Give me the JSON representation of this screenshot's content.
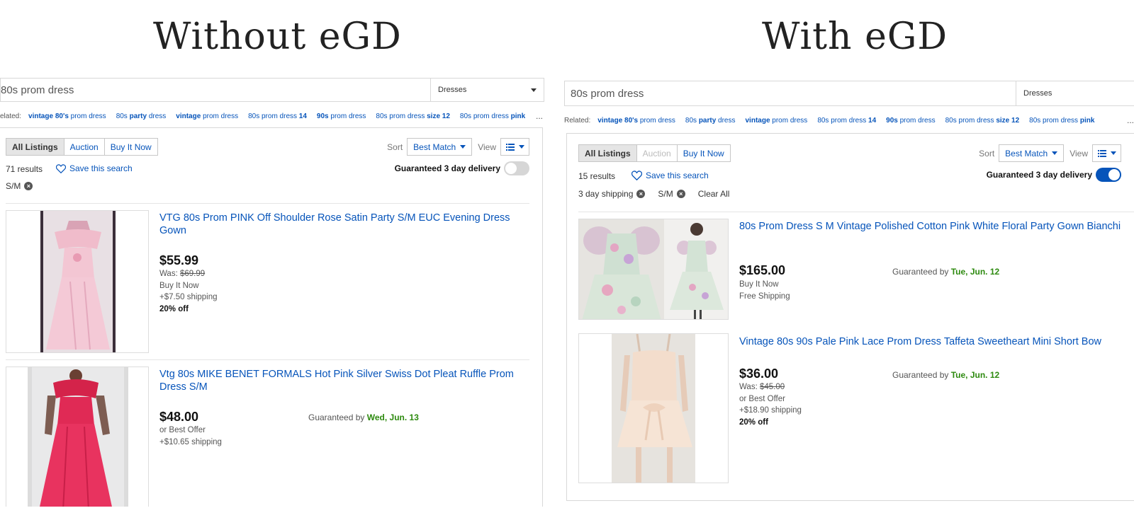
{
  "headings": {
    "left": "Without eGD",
    "right": "With eGD"
  },
  "colors": {
    "link": "#0654ba",
    "date_green": "#2d8a0f",
    "toggle_on": "#0654ba",
    "toggle_off": "#d6d6d6"
  },
  "left": {
    "search": {
      "query": "80s prom dress",
      "category": "Dresses"
    },
    "related": {
      "label": "elated:",
      "keywords": [
        {
          "normal1": "",
          "bold": "vintage 80's",
          "normal2": " prom dress"
        },
        {
          "normal1": "80s ",
          "bold": "party",
          "normal2": " dress"
        },
        {
          "normal1": "",
          "bold": "vintage",
          "normal2": " prom dress"
        },
        {
          "normal1": "80s prom dress ",
          "bold": "14",
          "normal2": ""
        },
        {
          "normal1": "",
          "bold": "90s",
          "normal2": " prom dress"
        },
        {
          "normal1": "80s prom dress ",
          "bold": "size 12",
          "normal2": ""
        },
        {
          "normal1": "80s prom dress ",
          "bold": "pink",
          "normal2": ""
        }
      ],
      "more": "..."
    },
    "tabs": [
      "All Listings",
      "Auction",
      "Buy It Now"
    ],
    "sort_label": "Sort",
    "sort_value": "Best Match",
    "view_label": "View",
    "count": "71 results",
    "save_search": "Save this search",
    "guaranteed_label": "Guaranteed 3 day delivery",
    "toggle_state": "off",
    "chips": [
      "S/M"
    ],
    "items": [
      {
        "title": "VTG 80s Prom PINK Off Shoulder Rose Satin Party S/M EUC Evening Dress Gown",
        "price": "$55.99",
        "was_label": "Was: ",
        "was_price": "$69.99",
        "format": "Buy It Now",
        "shipping": "+$7.50 shipping",
        "discount": "20% off"
      },
      {
        "title": "Vtg 80s MIKE BENET FORMALS Hot Pink Silver Swiss Dot Pleat Ruffle Prom Dress S/M",
        "price": "$48.00",
        "format": "or Best Offer",
        "shipping": "+$10.65 shipping",
        "guaranteed_label": "Guaranteed by ",
        "guaranteed_date": "Wed, Jun. 13"
      }
    ]
  },
  "right": {
    "search": {
      "query": "80s prom dress",
      "category": "Dresses"
    },
    "related": {
      "label": "Related:",
      "keywords": [
        {
          "normal1": "",
          "bold": "vintage 80's",
          "normal2": " prom dress"
        },
        {
          "normal1": "80s ",
          "bold": "party",
          "normal2": " dress"
        },
        {
          "normal1": "",
          "bold": "vintage",
          "normal2": " prom dress"
        },
        {
          "normal1": "80s prom dress ",
          "bold": "14",
          "normal2": ""
        },
        {
          "normal1": "",
          "bold": "90s",
          "normal2": " prom dress"
        },
        {
          "normal1": "80s prom dress ",
          "bold": "size 12",
          "normal2": ""
        },
        {
          "normal1": "80s prom dress ",
          "bold": "pink",
          "normal2": ""
        }
      ],
      "more": "..."
    },
    "tabs": [
      "All Listings",
      "Auction",
      "Buy It Now"
    ],
    "sort_label": "Sort",
    "sort_value": "Best Match",
    "view_label": "View",
    "count": "15 results",
    "save_search": "Save this search",
    "guaranteed_label": "Guaranteed 3 day delivery",
    "toggle_state": "on",
    "chips": [
      "3 day shipping",
      "S/M"
    ],
    "clear_all": "Clear All",
    "items": [
      {
        "title": "80s Prom Dress S M Vintage Polished Cotton Pink White Floral Party Gown Bianchi",
        "price": "$165.00",
        "format": "Buy It Now",
        "shipping": "Free Shipping",
        "guaranteed_label": "Guaranteed by ",
        "guaranteed_date": "Tue, Jun. 12"
      },
      {
        "title": "Vintage 80s 90s Pale Pink Lace Prom Dress Taffeta Sweetheart Mini Short Bow",
        "price": "$36.00",
        "was_label": "Was: ",
        "was_price": "$45.00",
        "format": "or Best Offer",
        "shipping": "+$18.90 shipping",
        "discount": "20% off",
        "guaranteed_label": "Guaranteed by ",
        "guaranteed_date": "Tue, Jun. 12"
      }
    ]
  }
}
